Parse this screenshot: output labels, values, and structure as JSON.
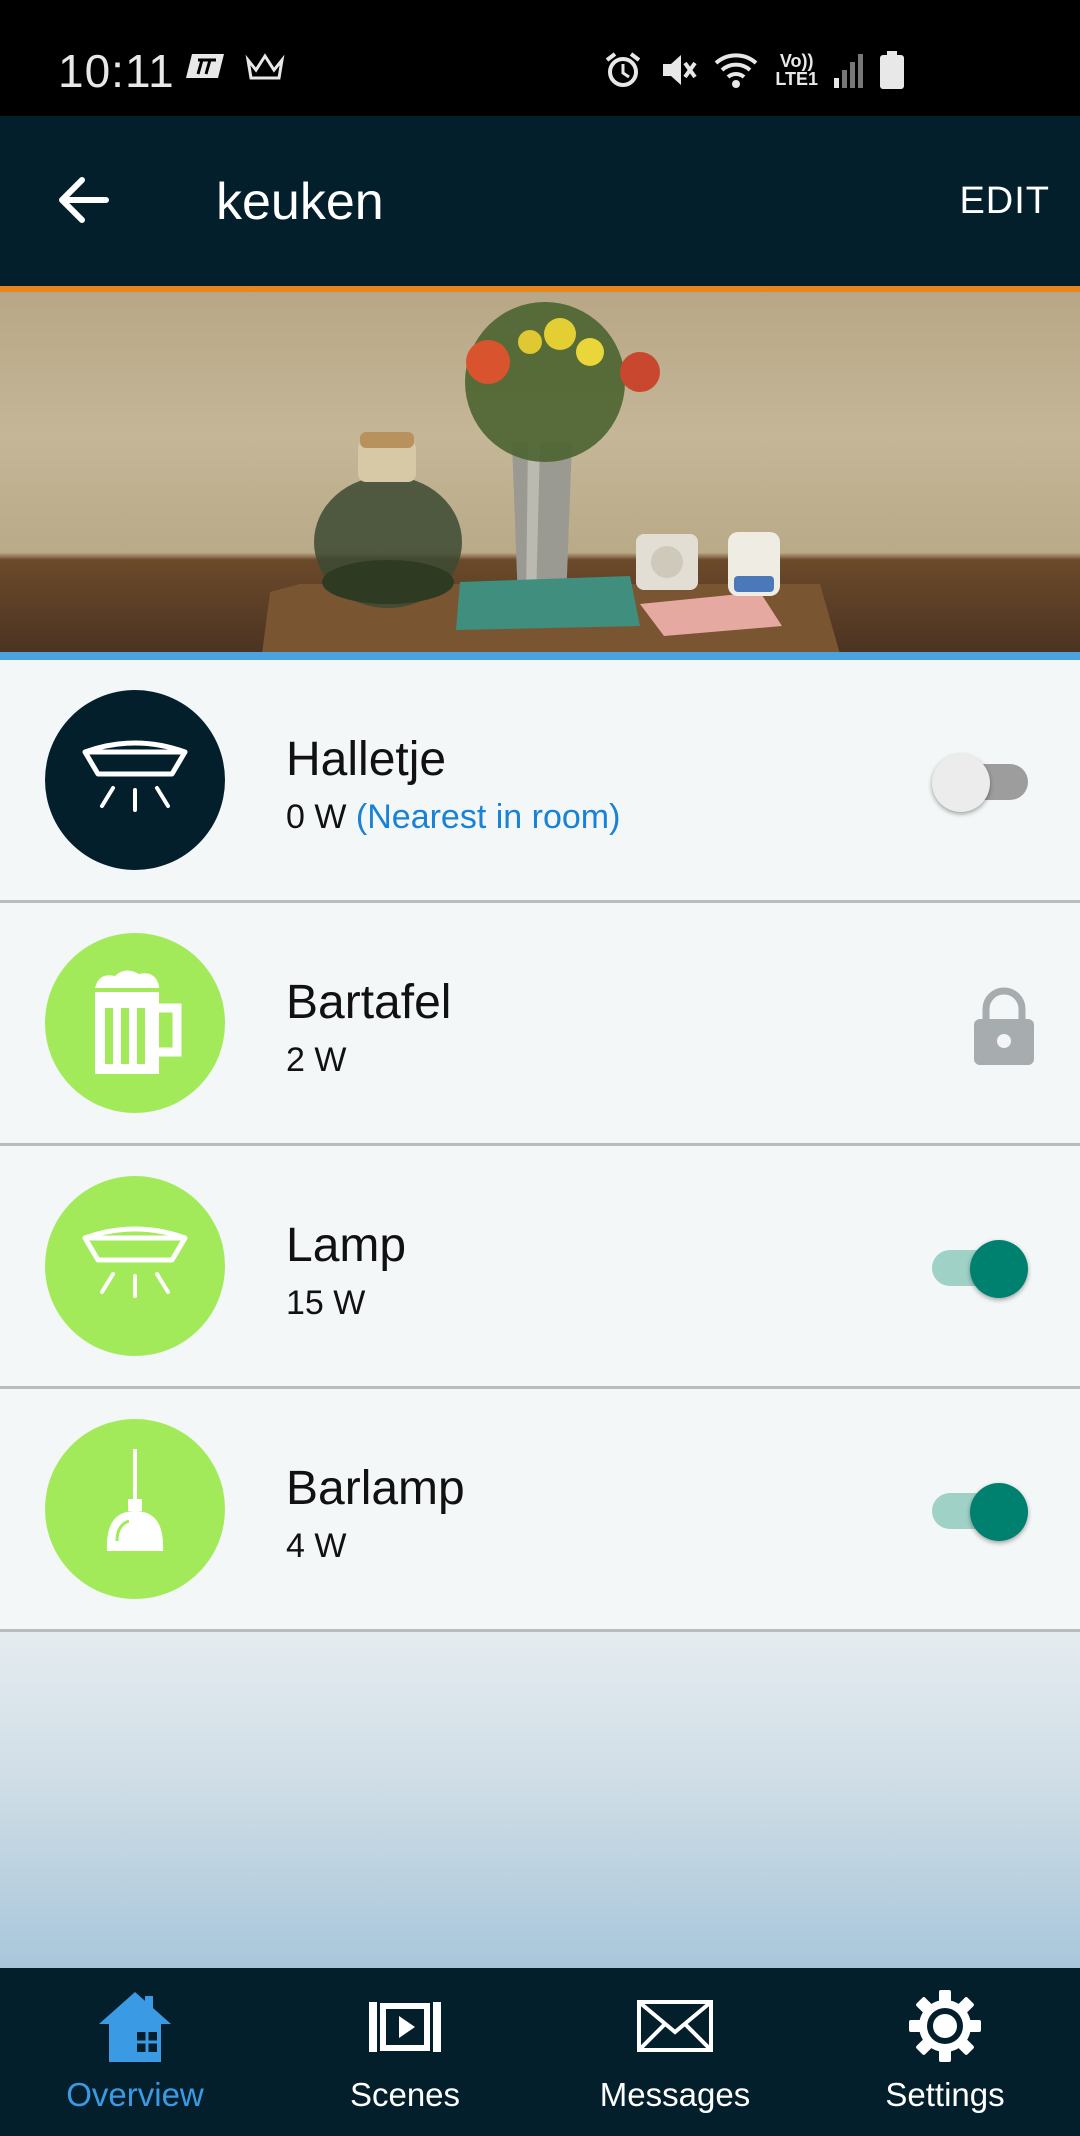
{
  "status_bar": {
    "time": "10:11",
    "lte_top": "Vo))",
    "lte_bottom": "LTE1"
  },
  "app_bar": {
    "title": "keuken",
    "edit_label": "EDIT"
  },
  "colors": {
    "accent_orange": "#e8861c",
    "accent_blue": "#4aa3de",
    "navy": "#041f2c",
    "device_green": "#a3ea5a",
    "toggle_on": "#00806e",
    "link_blue": "#1a82d4"
  },
  "devices": [
    {
      "name": "Halletje",
      "power": "0 W",
      "note": "(Nearest in room)",
      "icon": "ceiling-light-icon",
      "control": "toggle",
      "state": "off"
    },
    {
      "name": "Bartafel",
      "power": "2 W",
      "note": "",
      "icon": "beer-mug-icon",
      "control": "lock",
      "state": "locked"
    },
    {
      "name": "Lamp",
      "power": "15 W",
      "note": "",
      "icon": "ceiling-light-icon",
      "control": "toggle",
      "state": "on"
    },
    {
      "name": "Barlamp",
      "power": "4 W",
      "note": "",
      "icon": "pendant-lamp-icon",
      "control": "toggle",
      "state": "on"
    }
  ],
  "bottom_nav": {
    "items": [
      {
        "label": "Overview",
        "icon": "house-icon",
        "active": true
      },
      {
        "label": "Scenes",
        "icon": "scenes-icon",
        "active": false
      },
      {
        "label": "Messages",
        "icon": "envelope-icon",
        "active": false
      },
      {
        "label": "Settings",
        "icon": "gear-icon",
        "active": false
      }
    ]
  }
}
